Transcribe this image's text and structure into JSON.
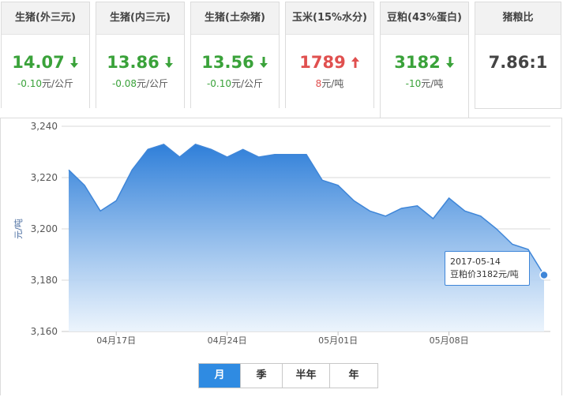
{
  "cards": [
    {
      "title": "生猪(外三元)",
      "price": "14.07",
      "direction": "down",
      "change_num": "-0.10",
      "change_unit": "元/公斤"
    },
    {
      "title": "生猪(内三元)",
      "price": "13.86",
      "direction": "down",
      "change_num": "-0.08",
      "change_unit": "元/公斤"
    },
    {
      "title": "生猪(土杂猪)",
      "price": "13.56",
      "direction": "down",
      "change_num": "-0.10",
      "change_unit": "元/公斤"
    },
    {
      "title": "玉米(15%水分)",
      "price": "1789",
      "direction": "up",
      "change_num": "8",
      "change_unit": "元/吨"
    },
    {
      "title": "豆粕(43%蛋白)",
      "price": "3182",
      "direction": "down",
      "change_num": "-10",
      "change_unit": "元/吨"
    },
    {
      "title": "猪粮比",
      "price": "7.86:1",
      "direction": "none",
      "change_num": "",
      "change_unit": ""
    }
  ],
  "colors": {
    "up": "#e0504f",
    "down": "#3aa23a",
    "line": "#3f86d8",
    "active_tab": "#2f8be2"
  },
  "tabs": [
    {
      "label": "月",
      "active": true
    },
    {
      "label": "季",
      "active": false
    },
    {
      "label": "半年",
      "active": false
    },
    {
      "label": "年",
      "active": false
    }
  ],
  "tooltip": {
    "date": "2017-05-14",
    "text": "豆粕价3182元/吨"
  },
  "chart_data": {
    "type": "area",
    "ylabel": "元/吨",
    "ylim": [
      3160,
      3240
    ],
    "yticks": [
      3160,
      3180,
      3200,
      3220,
      3240
    ],
    "ytick_labels": [
      "3,160",
      "3,180",
      "3,200",
      "3,220",
      "3,240"
    ],
    "xticks": [
      {
        "x": "2017-04-17",
        "label": "04月17日"
      },
      {
        "x": "2017-04-24",
        "label": "04月24日"
      },
      {
        "x": "2017-05-01",
        "label": "05月01日"
      },
      {
        "x": "2017-05-08",
        "label": "05月08日"
      }
    ],
    "grid": true,
    "series": [
      {
        "x": [
          "2017-04-14",
          "2017-04-15",
          "2017-04-16",
          "2017-04-17",
          "2017-04-18",
          "2017-04-19",
          "2017-04-20",
          "2017-04-21",
          "2017-04-22",
          "2017-04-23",
          "2017-04-24",
          "2017-04-25",
          "2017-04-26",
          "2017-04-27",
          "2017-04-28",
          "2017-04-29",
          "2017-04-30",
          "2017-05-01",
          "2017-05-02",
          "2017-05-03",
          "2017-05-04",
          "2017-05-05",
          "2017-05-06",
          "2017-05-07",
          "2017-05-08",
          "2017-05-09",
          "2017-05-10",
          "2017-05-11",
          "2017-05-12",
          "2017-05-13",
          "2017-05-14"
        ],
        "values": [
          3223,
          3217,
          3207,
          3211,
          3223,
          3231,
          3233,
          3228,
          3233,
          3231,
          3228,
          3231,
          3228,
          3229,
          3229,
          3229,
          3219,
          3217,
          3211,
          3207,
          3205,
          3208,
          3209,
          3204,
          3212,
          3207,
          3205,
          3200,
          3194,
          3192,
          3182
        ]
      }
    ]
  }
}
